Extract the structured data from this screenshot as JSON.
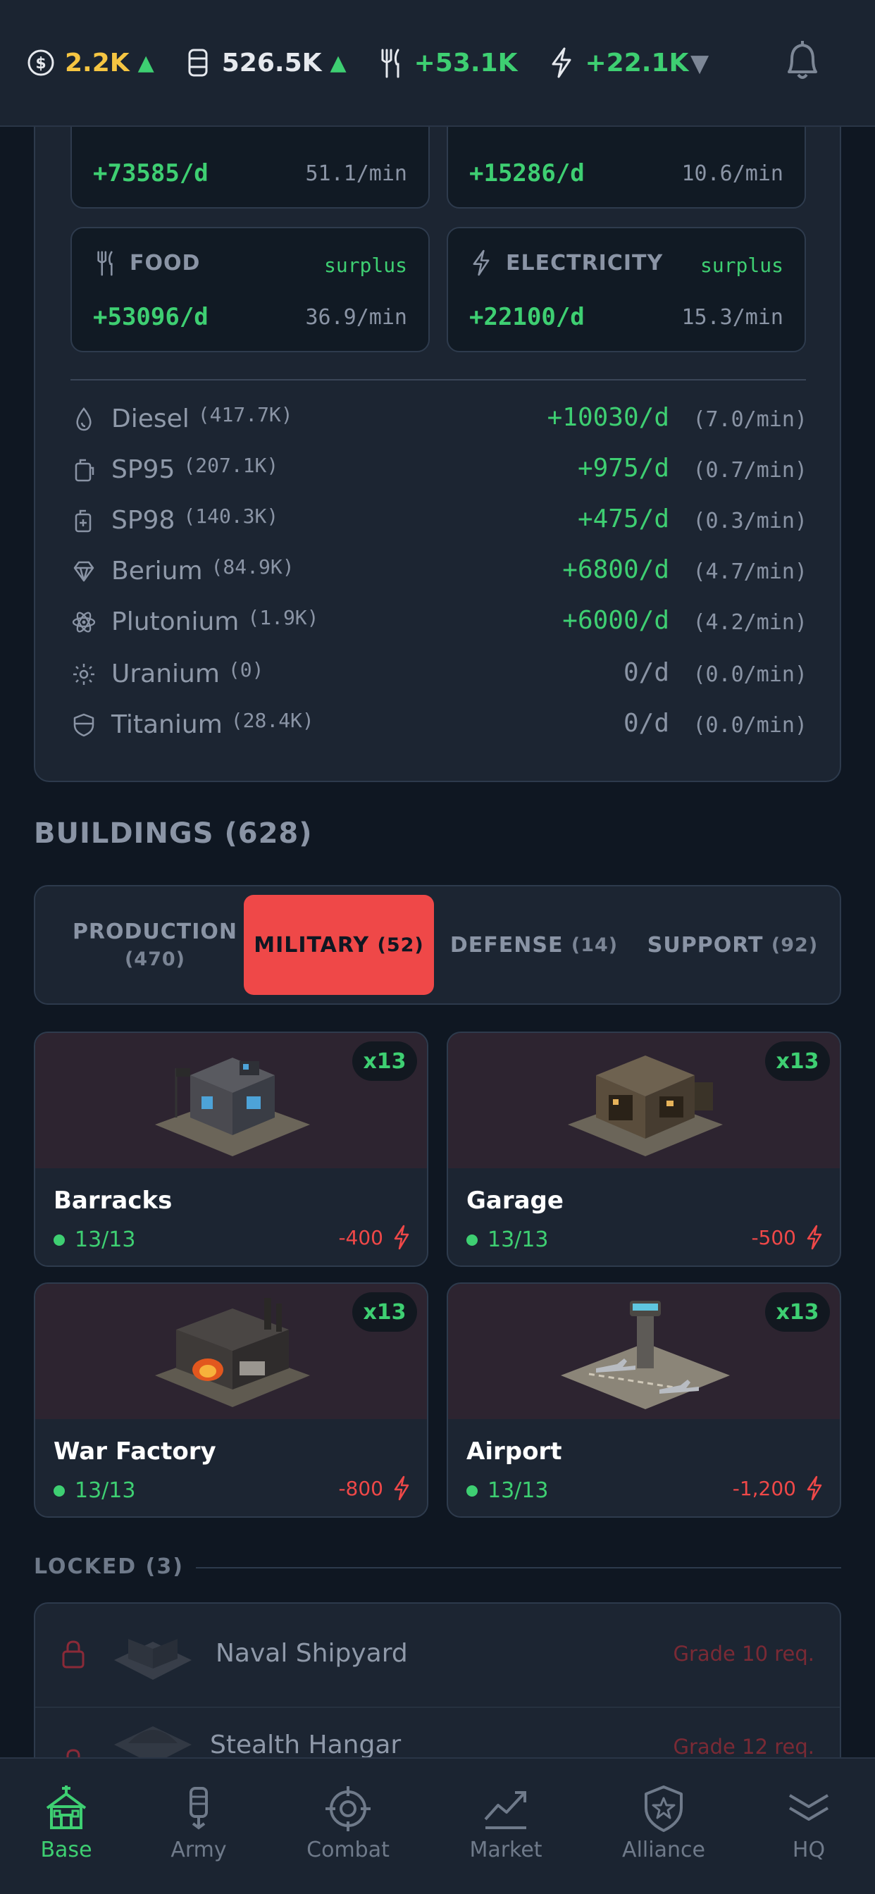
{
  "topbar": {
    "money": "2.2K",
    "oil": "526.5K",
    "food": "+53.1K",
    "electricity": "+22.1K"
  },
  "summary": {
    "tiles": [
      {
        "name": "",
        "state": "",
        "amount": "+73585/d",
        "rate": "51.1/min",
        "icon": "coin-icon"
      },
      {
        "name": "",
        "state": "",
        "amount": "+15286/d",
        "rate": "10.6/min",
        "icon": "barrel-icon"
      },
      {
        "name": "FOOD",
        "state": "surplus",
        "amount": "+53096/d",
        "rate": "36.9/min",
        "icon": "fork-knife-icon"
      },
      {
        "name": "ELECTRICITY",
        "state": "surplus",
        "amount": "+22100/d",
        "rate": "15.3/min",
        "icon": "bolt-icon"
      }
    ],
    "materials": [
      {
        "name": "Diesel",
        "stock": "(417.7K)",
        "per_day": "+10030/d",
        "per_min": "(7.0/min)",
        "icon": "drop-icon"
      },
      {
        "name": "SP95",
        "stock": "(207.1K)",
        "per_day": "+975/d",
        "per_min": "(0.7/min)",
        "icon": "fuel-can-icon"
      },
      {
        "name": "SP98",
        "stock": "(140.3K)",
        "per_day": "+475/d",
        "per_min": "(0.3/min)",
        "icon": "fuel-can-plus-icon"
      },
      {
        "name": "Berium",
        "stock": "(84.9K)",
        "per_day": "+6800/d",
        "per_min": "(4.7/min)",
        "icon": "gem-icon"
      },
      {
        "name": "Plutonium",
        "stock": "(1.9K)",
        "per_day": "+6000/d",
        "per_min": "(4.2/min)",
        "icon": "atom-icon"
      },
      {
        "name": "Uranium",
        "stock": "(0)",
        "per_day": "0/d",
        "per_min": "(0.0/min)",
        "icon": "radiation-icon"
      },
      {
        "name": "Titanium",
        "stock": "(28.4K)",
        "per_day": "0/d",
        "per_min": "(0.0/min)",
        "icon": "shield-icon"
      }
    ]
  },
  "buildings": {
    "title": "BUILDINGS (628)",
    "tabs": [
      {
        "label": "PRODUCTION",
        "count": "(470)"
      },
      {
        "label": "MILITARY",
        "count": "(52)"
      },
      {
        "label": "DEFENSE",
        "count": "(14)"
      },
      {
        "label": "SUPPORT",
        "count": "(92)"
      }
    ],
    "active_tab": "MILITARY",
    "cards": [
      {
        "name": "Barracks",
        "badge": "x13",
        "status": "13/13",
        "power": "-400"
      },
      {
        "name": "Garage",
        "badge": "x13",
        "status": "13/13",
        "power": "-500"
      },
      {
        "name": "War Factory",
        "badge": "x13",
        "status": "13/13",
        "power": "-800"
      },
      {
        "name": "Airport",
        "badge": "x13",
        "status": "13/13",
        "power": "-1,200"
      }
    ],
    "locked_title": "LOCKED (3)",
    "locked": [
      {
        "name": "Naval Shipyard",
        "requirement": "Grade 10 req."
      },
      {
        "name": "Stealth Hangar",
        "requirement": "Grade 12 req."
      }
    ]
  },
  "nav": {
    "items": [
      "Base",
      "Army",
      "Combat",
      "Market",
      "Alliance",
      "HQ"
    ],
    "active": "Base"
  },
  "colors": {
    "positive": "#3ecf72",
    "money": "#f5c542",
    "alert": "#ef4848",
    "background": "#0f1722",
    "panel": "#1c2532"
  }
}
